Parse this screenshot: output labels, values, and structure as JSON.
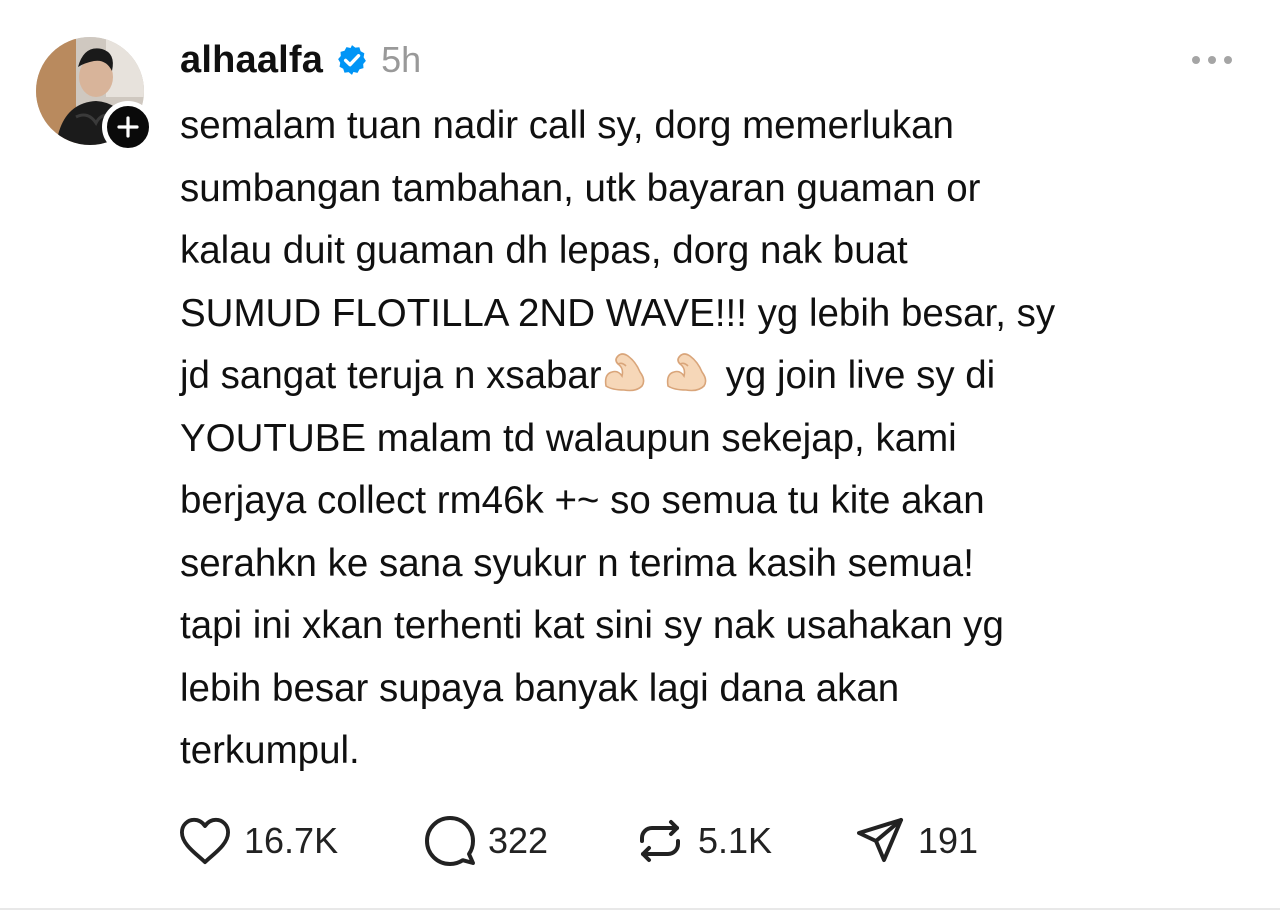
{
  "post": {
    "author": {
      "username": "alhaalfa",
      "verified": true,
      "avatar_icon": "profile-photo",
      "follow_icon": "plus-icon"
    },
    "timestamp": "5h",
    "more_icon": "more-dots-icon",
    "text_lines": [
      "semalam tuan nadir call sy, dorg memerlukan",
      "sumbangan tambahan, utk bayaran guaman or",
      "kalau duit guaman dh lepas, dorg nak buat",
      "SUMUD FLOTILLA 2ND WAVE!!! yg lebih besar, sy",
      "jd sangat teruja n xsabar",
      "yg join live sy di",
      "YOUTUBE malam td walaupun sekejap, kami",
      "berjaya collect rm46k +~ so semua tu kite akan",
      "serahkn ke sana syukur n terima kasih semua!",
      "tapi ini xkan terhenti kat sini sy nak usahakan yg",
      "lebih besar supaya banyak lagi dana akan",
      "terkumpul."
    ],
    "emojis": [
      "flexed-biceps-emoji",
      "flexed-biceps-emoji"
    ],
    "actions": {
      "likes": "16.7K",
      "replies": "322",
      "reposts": "5.1K",
      "shares": "191"
    }
  },
  "colors": {
    "text": "#101010",
    "muted": "#999999",
    "verified_blue": "#0095f6",
    "icon": "#222222"
  }
}
